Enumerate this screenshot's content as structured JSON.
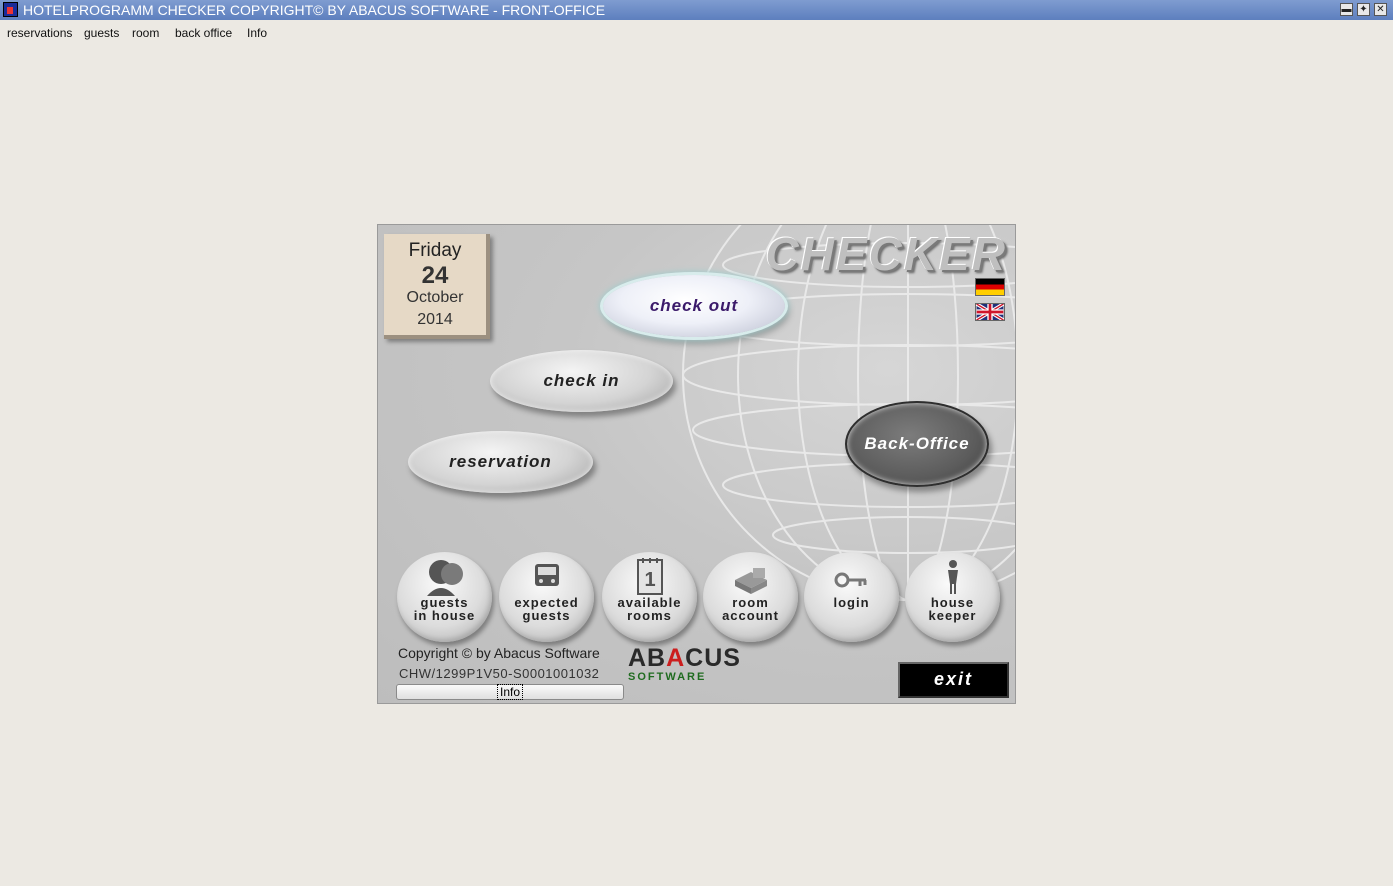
{
  "window": {
    "title": "HOTELPROGRAMM CHECKER COPYRIGHT© BY ABACUS SOFTWARE - FRONT-OFFICE",
    "minimize": "▬",
    "maximize": "✦",
    "close": "✕"
  },
  "menu": [
    "reservations",
    "guests",
    "room",
    "back office",
    "Info"
  ],
  "logo": "CHECKER",
  "calendar": {
    "weekday": "Friday",
    "day": "24",
    "month": "October",
    "year": "2014"
  },
  "buttons": {
    "check_out": "check out",
    "check_in": "check in",
    "reservation": "reservation",
    "back_office": "Back-Office",
    "exit": "exit"
  },
  "bottom_buttons": [
    {
      "line1": "guests",
      "line2": "in house",
      "icon": "guests-icon"
    },
    {
      "line1": "expected",
      "line2": "guests",
      "icon": "bus-icon"
    },
    {
      "line1": "available",
      "line2": "rooms",
      "icon": "calendar-icon",
      "icon_text": "1"
    },
    {
      "line1": "room",
      "line2": "account",
      "icon": "bed-icon"
    },
    {
      "line1": "login",
      "line2": "",
      "icon": "key-icon"
    },
    {
      "line1": "house",
      "line2": "keeper",
      "icon": "person-icon"
    }
  ],
  "footer": {
    "copyright": "Copyright © by  Abacus Software",
    "serial": "CHW/1299P1V50-S0001001032",
    "info": "Info",
    "brand_a": "AB",
    "brand_b": "A",
    "brand_c": "CUS",
    "brand_sub": "SOFTWARE"
  },
  "colors": {
    "titlebar": "#5d7fbe",
    "background": "#ece9e3",
    "checkout_text": "#3b1a6a",
    "backoffice": "#5c5c5c",
    "brand_red": "#cc1e1e",
    "brand_green": "#1f6b1f"
  }
}
